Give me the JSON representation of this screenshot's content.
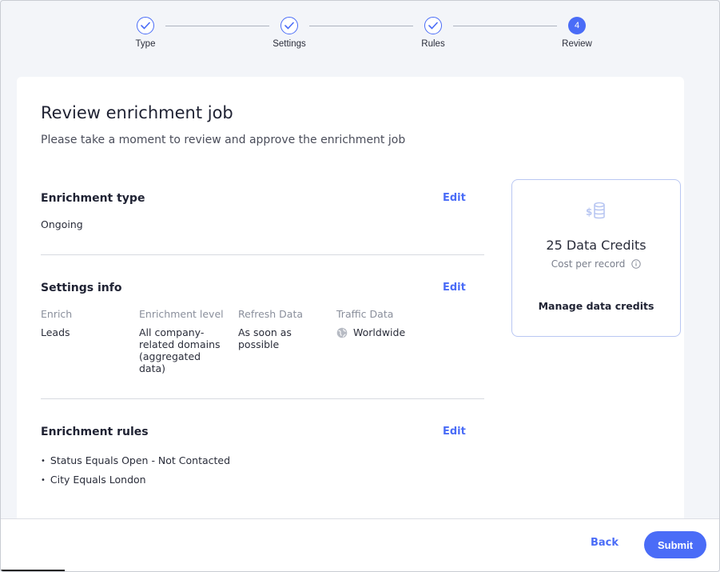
{
  "stepper": {
    "steps": [
      {
        "label": "Type",
        "state": "done"
      },
      {
        "label": "Settings",
        "state": "done"
      },
      {
        "label": "Rules",
        "state": "done"
      },
      {
        "label": "Review",
        "state": "active",
        "number": "4"
      }
    ]
  },
  "header": {
    "title": "Review enrichment job",
    "subtitle": "Please take a moment to review and approve the enrichment job"
  },
  "enrichment_type": {
    "title": "Enrichment type",
    "edit_label": "Edit",
    "value": "Ongoing"
  },
  "settings_info": {
    "title": "Settings info",
    "edit_label": "Edit",
    "columns": [
      {
        "label": "Enrich",
        "value": "Leads"
      },
      {
        "label": "Enrichment level",
        "value": "All company-related domains (aggregated data)"
      },
      {
        "label": "Refresh Data",
        "value": "As soon as possible"
      },
      {
        "label": "Traffic Data",
        "value": "Worldwide"
      }
    ]
  },
  "enrichment_rules": {
    "title": "Enrichment rules",
    "edit_label": "Edit",
    "rules": [
      "Status Equals Open - Not Contacted",
      "City Equals London"
    ]
  },
  "credits": {
    "icon": "coins-dollar-icon",
    "amount": "25 Data Credits",
    "cost_label": "Cost per record",
    "manage_label": "Manage data credits"
  },
  "footer": {
    "back_label": "Back",
    "submit_label": "Submit"
  },
  "colors": {
    "accent": "#4a6cf7",
    "background": "#f3f5f9"
  }
}
